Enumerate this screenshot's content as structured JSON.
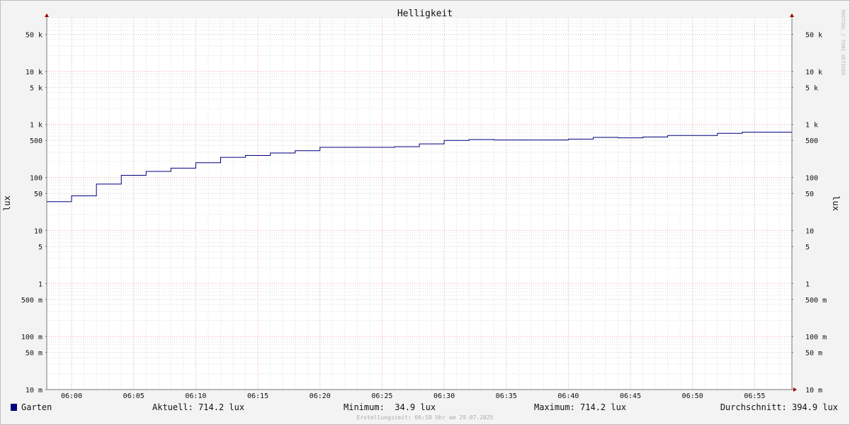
{
  "chart_data": {
    "type": "line",
    "title": "Helligkeit",
    "ylabel": "lux",
    "ylabel_right": "lux",
    "y_scale": "log",
    "ylim": [
      0.01,
      100000
    ],
    "xlim": [
      "05:58",
      "06:58"
    ],
    "y_ticks": [
      {
        "value": 50000,
        "label": "50 k"
      },
      {
        "value": 10000,
        "label": "10 k"
      },
      {
        "value": 5000,
        "label": "5 k"
      },
      {
        "value": 1000,
        "label": "1 k"
      },
      {
        "value": 500,
        "label": "500"
      },
      {
        "value": 100,
        "label": "100"
      },
      {
        "value": 50,
        "label": "50"
      },
      {
        "value": 10,
        "label": "10"
      },
      {
        "value": 5,
        "label": "5"
      },
      {
        "value": 1,
        "label": "1"
      },
      {
        "value": 0.5,
        "label": "500 m"
      },
      {
        "value": 0.1,
        "label": "100 m"
      },
      {
        "value": 0.05,
        "label": "50 m"
      },
      {
        "value": 0.01,
        "label": "10 m"
      }
    ],
    "x_ticks": [
      "06:00",
      "06:05",
      "06:10",
      "06:15",
      "06:20",
      "06:25",
      "06:30",
      "06:35",
      "06:40",
      "06:45",
      "06:50",
      "06:55"
    ],
    "grid": true,
    "series": [
      {
        "name": "Garten",
        "color": "#000080",
        "step": true,
        "x": [
          "05:58",
          "06:00",
          "06:02",
          "06:04",
          "06:06",
          "06:08",
          "06:10",
          "06:12",
          "06:14",
          "06:16",
          "06:18",
          "06:20",
          "06:22",
          "06:24",
          "06:26",
          "06:28",
          "06:30",
          "06:32",
          "06:34",
          "06:36",
          "06:38",
          "06:40",
          "06:42",
          "06:44",
          "06:46",
          "06:48",
          "06:50",
          "06:52",
          "06:54",
          "06:56",
          "06:58"
        ],
        "values": [
          34.9,
          45,
          75,
          110,
          130,
          150,
          190,
          240,
          260,
          290,
          320,
          370,
          370,
          370,
          380,
          430,
          500,
          520,
          510,
          510,
          510,
          530,
          570,
          560,
          580,
          620,
          620,
          680,
          714.2,
          714.2,
          714.2
        ]
      }
    ]
  },
  "legend": {
    "series_name": "Garten",
    "swatch_color": "#000080",
    "aktuell": "Aktuell: 714.2 lux",
    "minimum": "Minimum:  34.9 lux",
    "maximum": "Maximum: 714.2 lux",
    "durchschnitt": "Durchschnitt: 394.9 lux"
  },
  "footer": "Erstellungszeit: 06:58 Uhr am 29.07.2025",
  "watermark": "RRDTOOL / TOBI OETIKER"
}
